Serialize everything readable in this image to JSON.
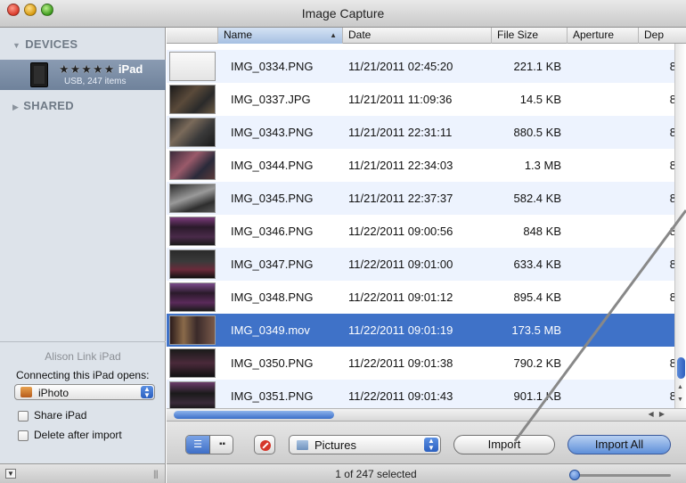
{
  "window": {
    "title": "Image Capture"
  },
  "sidebar": {
    "devices_header": "DEVICES",
    "shared_header": "SHARED",
    "device": {
      "name_mask": "★★★★★",
      "name_suffix": "iPad",
      "subtitle": "USB, 247 items"
    },
    "device_label": "Alison Link iPad",
    "opens_label": "Connecting this iPad opens:",
    "opens_app": "iPhoto",
    "share_label": "Share iPad",
    "share_checked": false,
    "delete_label": "Delete after import",
    "delete_checked": false
  },
  "table": {
    "columns": {
      "name": "Name",
      "date": "Date",
      "size": "File Size",
      "aperture": "Aperture",
      "depth": "Dep"
    },
    "rows": [
      {
        "name": "IMG_0334.PNG",
        "date": "11/21/2011 02:45:20",
        "size": "221.1 KB",
        "depth": "8",
        "selected": false
      },
      {
        "name": "IMG_0337.JPG",
        "date": "11/21/2011 11:09:36",
        "size": "14.5 KB",
        "depth": "8",
        "selected": false
      },
      {
        "name": "IMG_0343.PNG",
        "date": "11/21/2011 22:31:11",
        "size": "880.5 KB",
        "depth": "8",
        "selected": false
      },
      {
        "name": "IMG_0344.PNG",
        "date": "11/21/2011 22:34:03",
        "size": "1.3 MB",
        "depth": "8",
        "selected": false
      },
      {
        "name": "IMG_0345.PNG",
        "date": "11/21/2011 22:37:37",
        "size": "582.4 KB",
        "depth": "8",
        "selected": false
      },
      {
        "name": "IMG_0346.PNG",
        "date": "11/22/2011 09:00:56",
        "size": "848 KB",
        "depth": "8",
        "selected": false
      },
      {
        "name": "IMG_0347.PNG",
        "date": "11/22/2011 09:01:00",
        "size": "633.4 KB",
        "depth": "8",
        "selected": false
      },
      {
        "name": "IMG_0348.PNG",
        "date": "11/22/2011 09:01:12",
        "size": "895.4 KB",
        "depth": "8",
        "selected": false
      },
      {
        "name": "IMG_0349.mov",
        "date": "11/22/2011 09:01:19",
        "size": "173.5 MB",
        "depth": "",
        "selected": true
      },
      {
        "name": "IMG_0350.PNG",
        "date": "11/22/2011 09:01:38",
        "size": "790.2 KB",
        "depth": "8",
        "selected": false
      },
      {
        "name": "IMG_0351.PNG",
        "date": "11/22/2011 09:01:43",
        "size": "901.1 KB",
        "depth": "8",
        "selected": false
      }
    ]
  },
  "toolbar": {
    "destination": "Pictures",
    "import_label": "Import",
    "import_all_label": "Import All"
  },
  "status": {
    "text": "1 of 247 selected"
  },
  "colors": {
    "selection": "#3f72c8",
    "alt_row": "#edf3fe",
    "sidebar": "#dde3ea"
  },
  "icons": [
    "close-icon",
    "minimize-icon",
    "zoom-icon",
    "ipad-icon",
    "iphoto-icon",
    "list-view-icon",
    "grid-view-icon",
    "delete-icon",
    "folder-icon"
  ]
}
